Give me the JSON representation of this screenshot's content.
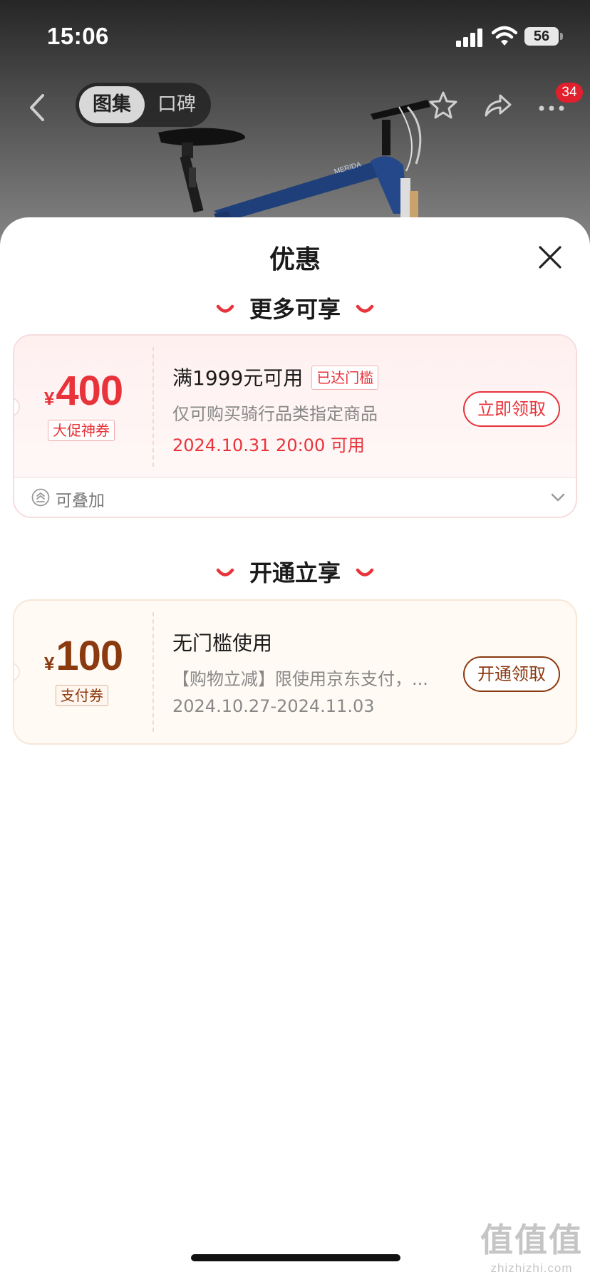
{
  "status_bar": {
    "time": "15:06",
    "battery": "56"
  },
  "top_nav": {
    "tabs": [
      "图集",
      "口碑"
    ],
    "active_tab": "图集",
    "cart_badge": "34"
  },
  "sheet": {
    "title": "优惠",
    "sections": [
      {
        "heading": "更多可享",
        "coupon": {
          "currency": "¥",
          "amount": "400",
          "tag": "大促神券",
          "condition": "满1999元可用",
          "condition_badge": "已达门槛",
          "description": "仅可购买骑行品类指定商品",
          "validity": "2024.10.31 20:00 可用",
          "button": "立即领取",
          "stack_label": "可叠加"
        }
      },
      {
        "heading": "开通立享",
        "coupon": {
          "currency": "¥",
          "amount": "100",
          "tag": "支付券",
          "condition": "无门槛使用",
          "description": "【购物立减】限使用京东支付，...",
          "validity": "2024.10.27-2024.11.03",
          "button": "开通领取"
        }
      }
    ]
  },
  "watermark": {
    "big": "值值值",
    "small": "zhizhizhi.com"
  },
  "colors": {
    "accent_red": "#e8333a",
    "accent_brown": "#8b3a10"
  }
}
